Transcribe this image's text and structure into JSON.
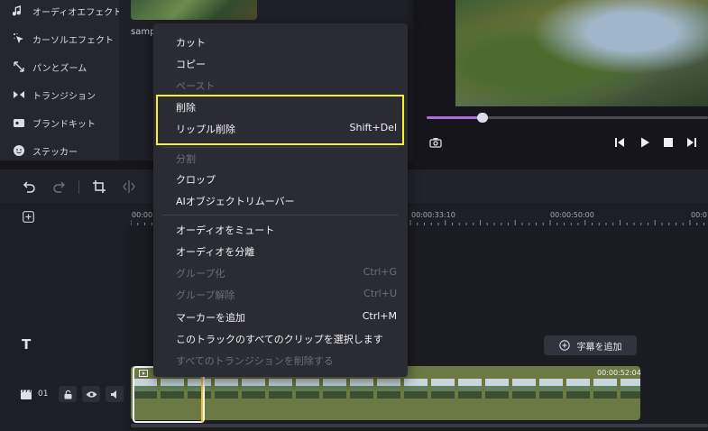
{
  "sidebar": {
    "items": [
      {
        "label": "オーディオエフェクト",
        "icon": "music-note-icon"
      },
      {
        "label": "カーソルエフェクト",
        "icon": "cursor-sparkle-icon"
      },
      {
        "label": "パンとズーム",
        "icon": "pan-zoom-icon"
      },
      {
        "label": "トランジション",
        "icon": "transition-icon"
      },
      {
        "label": "ブランドキット",
        "icon": "brand-kit-icon"
      },
      {
        "label": "ステッカー",
        "icon": "sticker-icon"
      }
    ]
  },
  "media": {
    "thumbnail_label": "samp"
  },
  "preview": {
    "progress": 0.2
  },
  "ruler": {
    "labels": [
      "00:00",
      "00:00:33:10",
      "00:00:50:00",
      "00:01"
    ]
  },
  "context_menu": {
    "items": [
      {
        "label": "カット",
        "enabled": true,
        "shortcut": ""
      },
      {
        "label": "コピー",
        "enabled": true,
        "shortcut": ""
      },
      {
        "label": "ペースト",
        "enabled": false,
        "shortcut": ""
      },
      {
        "label": "削除",
        "enabled": true,
        "shortcut": ""
      },
      {
        "label": "リップル削除",
        "enabled": true,
        "shortcut": "Shift+Del"
      },
      {
        "label": "分割",
        "enabled": false,
        "shortcut": ""
      },
      {
        "label": "クロップ",
        "enabled": true,
        "shortcut": ""
      },
      {
        "label": "AIオブジェクトリムーバー",
        "enabled": true,
        "shortcut": ""
      },
      {
        "label": "オーディオをミュート",
        "enabled": true,
        "shortcut": ""
      },
      {
        "label": "オーディオを分離",
        "enabled": true,
        "shortcut": ""
      },
      {
        "label": "グループ化",
        "enabled": false,
        "shortcut": "Ctrl+G"
      },
      {
        "label": "グループ解除",
        "enabled": false,
        "shortcut": "Ctrl+U"
      },
      {
        "label": "マーカーを追加",
        "enabled": true,
        "shortcut": "Ctrl+M"
      },
      {
        "label": "このトラックのすべてのクリップを選択します",
        "enabled": true,
        "shortcut": ""
      },
      {
        "label": "すべてのトランジションを削除する",
        "enabled": false,
        "shortcut": ""
      }
    ]
  },
  "timeline": {
    "text_track_icon": "T",
    "add_caption_label": "字幕を追加",
    "track_number": "01",
    "clip_duration": "00:00:52:04"
  },
  "colors": {
    "highlight": "#f2f230",
    "playhead": "#f0c030",
    "progress": "#b06be0",
    "clip_track": "#6b7a45"
  }
}
